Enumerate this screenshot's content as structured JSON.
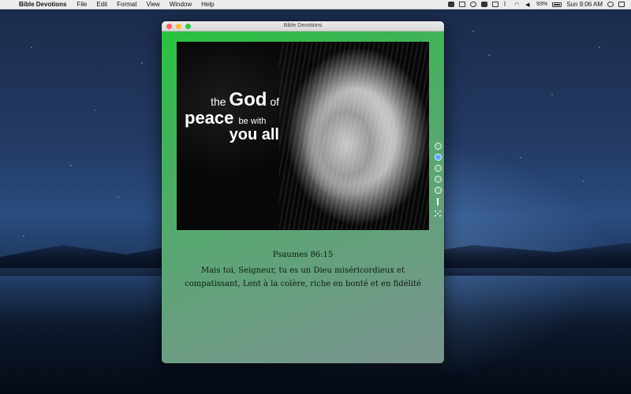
{
  "menubar": {
    "app_name": "Bible Devotions",
    "items": [
      "File",
      "Edit",
      "Format",
      "View",
      "Window",
      "Help"
    ],
    "battery_percent": "93%",
    "clock": "Sun 9:06 AM"
  },
  "window": {
    "title": "Bible Devotions"
  },
  "image": {
    "text_line1_pre": "the",
    "text_line1_bold": "God",
    "text_line1_post": "of",
    "text_line2_bold": "peace",
    "text_line2_post": "be with",
    "text_line3": "you all"
  },
  "tools": [
    "cloud-icon",
    "radio-icon",
    "chat-icon",
    "info-icon",
    "plus-circle-icon",
    "pin-icon",
    "sparkle-icon"
  ],
  "verse": {
    "reference": "Psaumes 86:15",
    "text": "Mais toi, Seigneur, tu es un Dieu miséricordieux et compatissant, Lent à la colère, riche en bonté et en fidélité"
  },
  "colors": {
    "window_gradient_start": "#27c43d",
    "window_gradient_end": "#7a9490",
    "selected_tool": "#5ea6ff"
  }
}
